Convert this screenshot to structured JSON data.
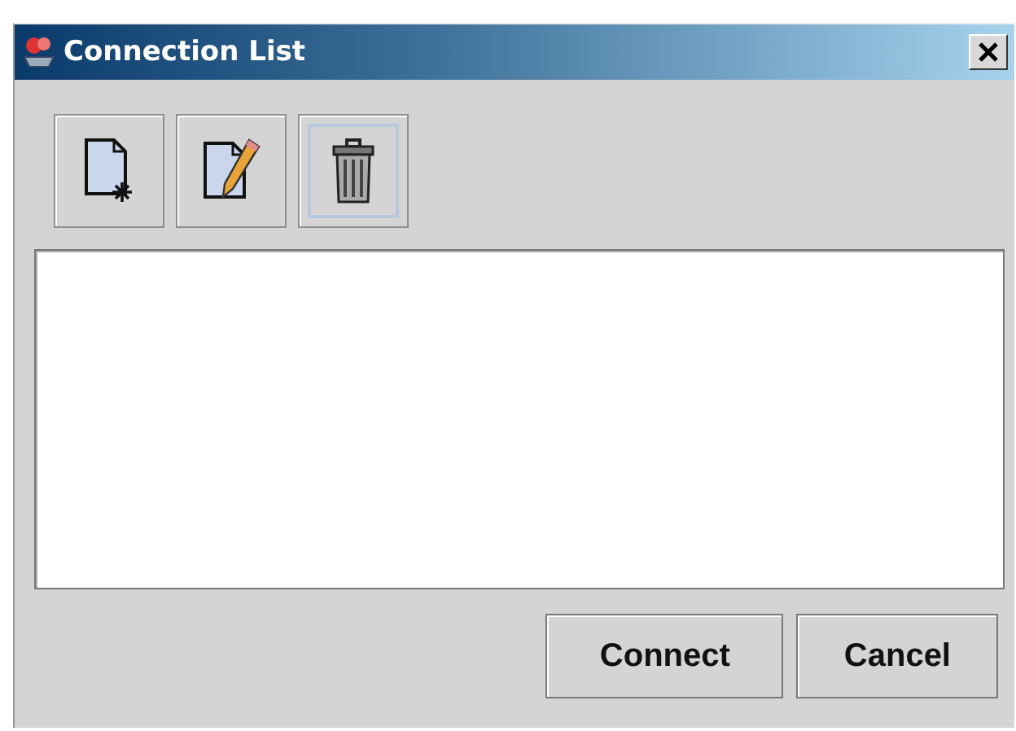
{
  "window": {
    "title": "Connection List"
  },
  "toolbar": [
    {
      "kind": "new",
      "focused": false
    },
    {
      "kind": "edit",
      "focused": false
    },
    {
      "kind": "delete",
      "focused": true
    }
  ],
  "buttons": [
    "Connect",
    "Cancel"
  ]
}
